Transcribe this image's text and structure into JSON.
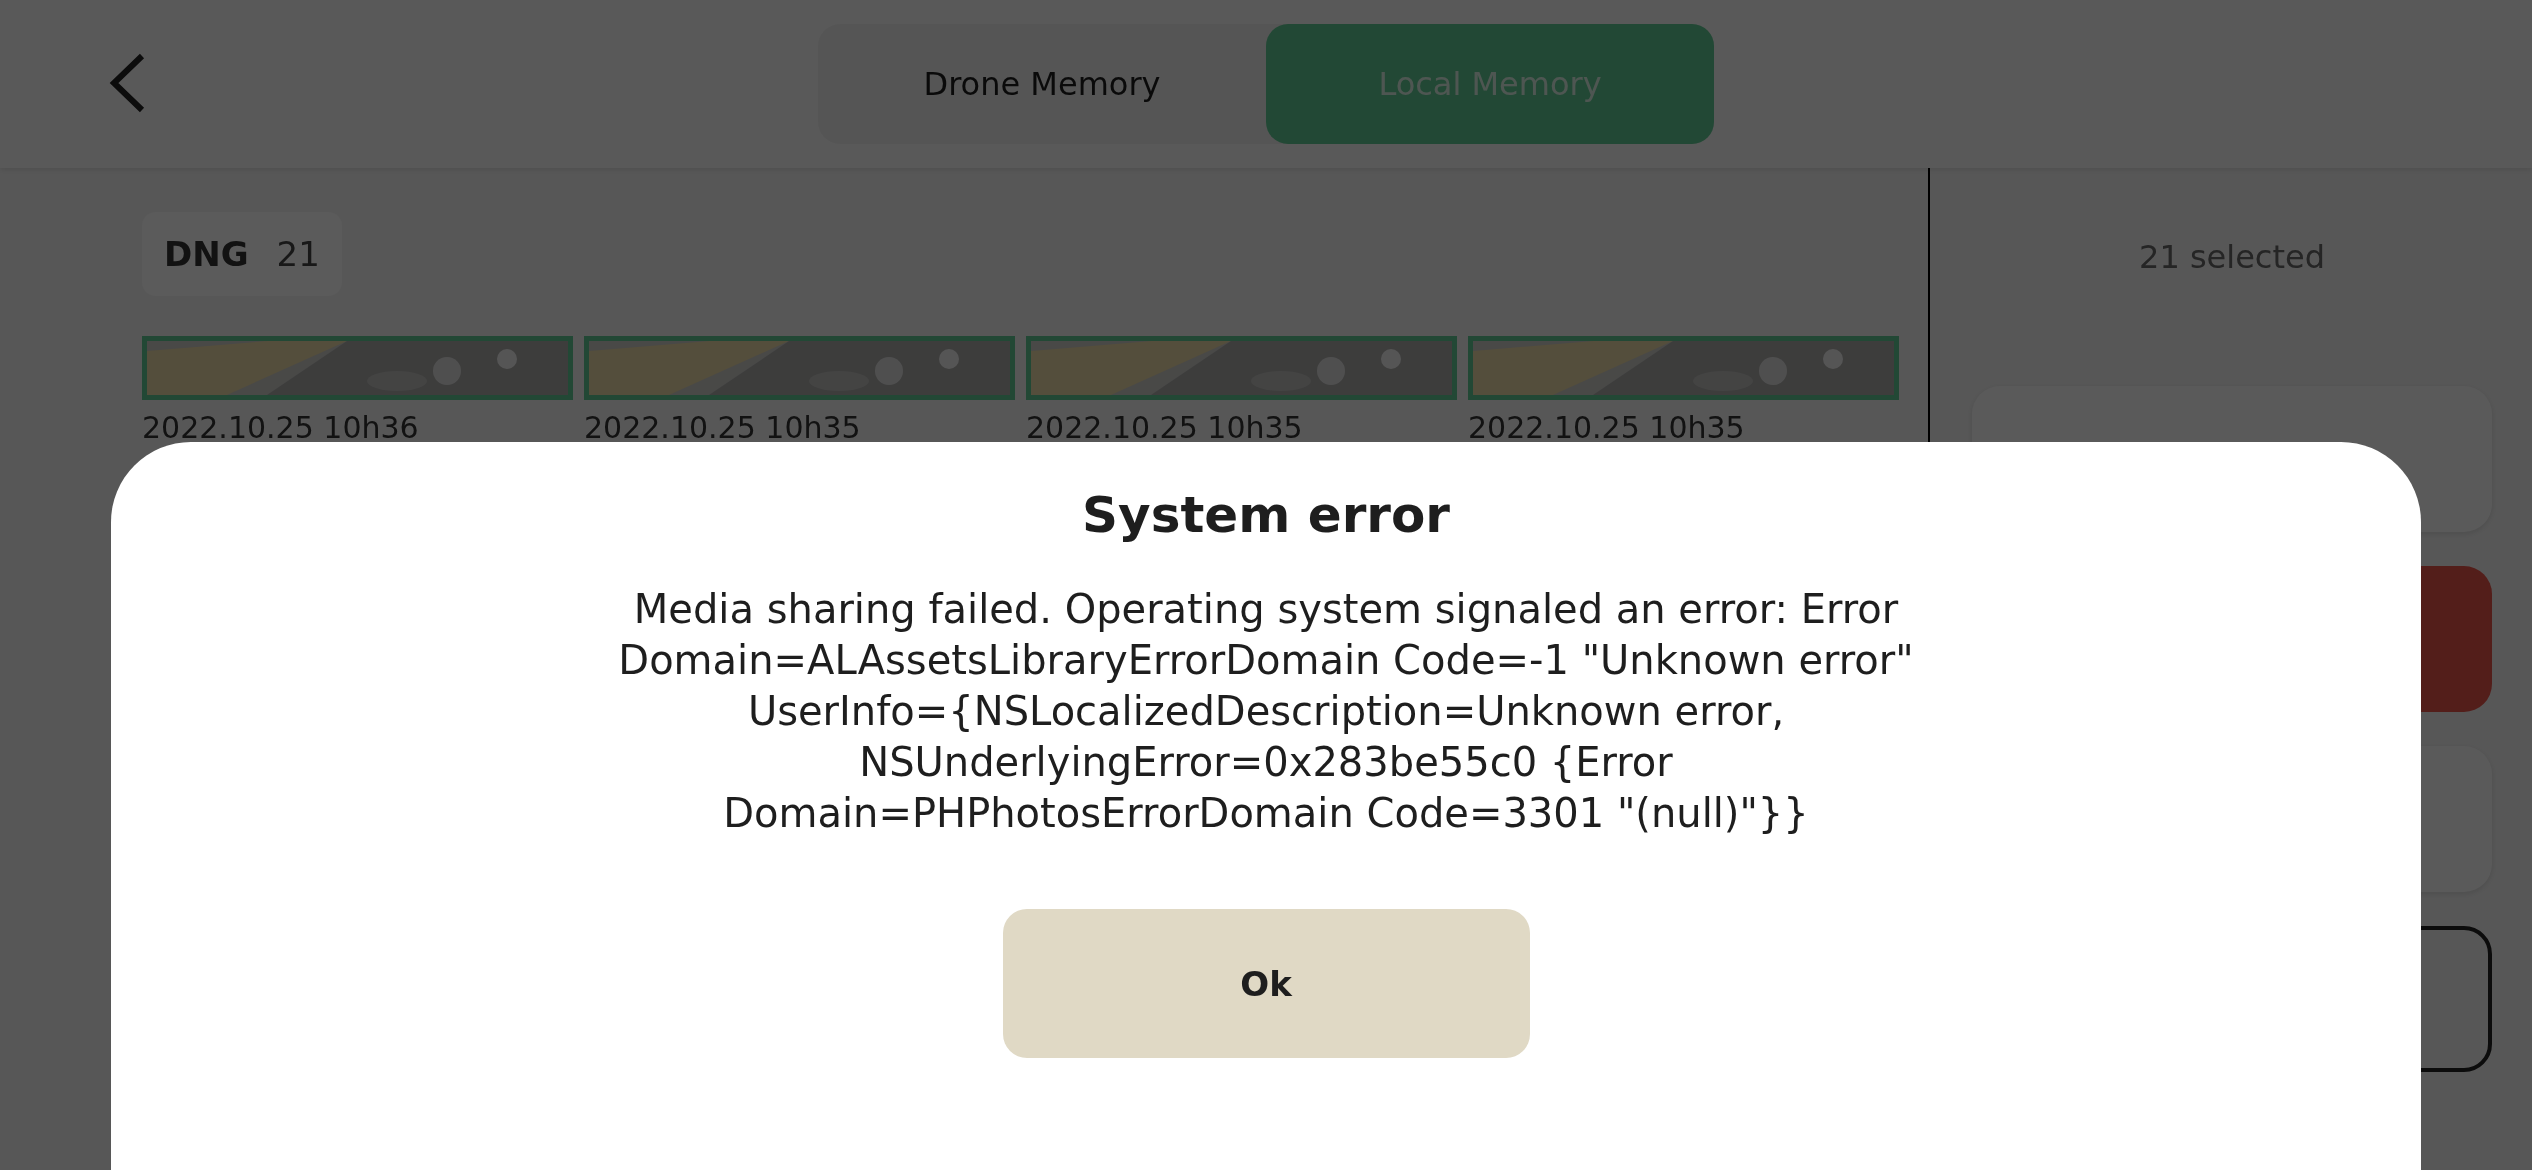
{
  "header": {
    "tabs": [
      {
        "label": "Drone Memory",
        "selected": false
      },
      {
        "label": "Local Memory",
        "selected": true
      }
    ]
  },
  "filter": {
    "label": "DNG",
    "count": "21"
  },
  "thumbnails": [
    {
      "caption": "2022.10.25 10h36",
      "selected": true
    },
    {
      "caption": "2022.10.25 10h35",
      "selected": true
    },
    {
      "caption": "2022.10.25 10h35",
      "selected": true
    },
    {
      "caption": "2022.10.25 10h35",
      "selected": true
    }
  ],
  "side_panel": {
    "selection_count": "21 selected",
    "actions": [
      {
        "kind": "card"
      },
      {
        "kind": "danger"
      },
      {
        "kind": "card"
      },
      {
        "kind": "outline"
      }
    ]
  },
  "dialog": {
    "title": "System error",
    "message": "Media sharing failed. Operating system signaled an error: Error Domain=ALAssetsLibraryErrorDomain Code=-1 \"Unknown error\" UserInfo={NSLocalizedDescription=Unknown error, NSUnderlyingError=0x283be55c0 {Error Domain=PHPhotosErrorDomain Code=3301 \"(null)\"}}",
    "button": "Ok"
  }
}
